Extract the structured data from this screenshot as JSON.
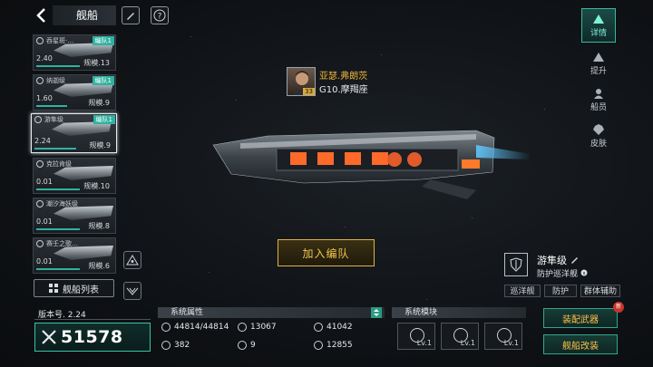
{
  "header": {
    "title": "舰船",
    "back_icon": "chevron-left-icon",
    "edit_icon": "pencil-icon",
    "help_icon": "question-icon"
  },
  "ship_list": [
    {
      "name": "吞星斑·…",
      "fleet": "编队1",
      "value": "2.40",
      "scale": "规模.13",
      "selected": false
    },
    {
      "name": "纳迦级",
      "fleet": "编队1",
      "value": "1.60",
      "scale": "规模.9",
      "selected": false
    },
    {
      "name": "游隼级",
      "fleet": "编队1",
      "value": "2.24",
      "scale": "规模.9",
      "selected": true
    },
    {
      "name": "克拉肯级",
      "fleet": "",
      "value": "0.01",
      "scale": "规模.10",
      "selected": false
    },
    {
      "name": "潮汐海妖级",
      "fleet": "",
      "value": "0.01",
      "scale": "规模.8",
      "selected": false
    },
    {
      "name": "赛壬之歌…",
      "fleet": "",
      "value": "0.01",
      "scale": "规模.6",
      "selected": false
    }
  ],
  "list_button": {
    "label": "舰船列表"
  },
  "nav": [
    {
      "label": "详情",
      "active": true
    },
    {
      "label": "提升",
      "active": false
    },
    {
      "label": "船员",
      "active": false
    },
    {
      "label": "皮肤",
      "active": false
    }
  ],
  "captain": {
    "name": "亚瑟.弗朗茨",
    "seat": "G10.摩羯座",
    "level": "33"
  },
  "join_button": {
    "label": "加入编队"
  },
  "ship_class": {
    "name": "游隼级",
    "subtype": "防护巡洋舰",
    "tags": [
      "巡洋舰",
      "防护",
      "群体辅助"
    ]
  },
  "version": "版本号. 2.24",
  "power": "51578",
  "attributes": {
    "title": "系统属性",
    "items": [
      "44814/44814",
      "13067",
      "41042",
      "382",
      "9",
      "12855"
    ]
  },
  "modules": {
    "title": "系统模块",
    "items": [
      {
        "level": "Lv.1"
      },
      {
        "level": "Lv.1"
      },
      {
        "level": "Lv.1"
      }
    ]
  },
  "actions": {
    "equip": "装配武器",
    "modify": "舰船改装",
    "new_badge": "新"
  },
  "colors": {
    "accent": "#36b8a2",
    "gold": "#e0b340",
    "fleet_tag": "#2fb2a0"
  }
}
